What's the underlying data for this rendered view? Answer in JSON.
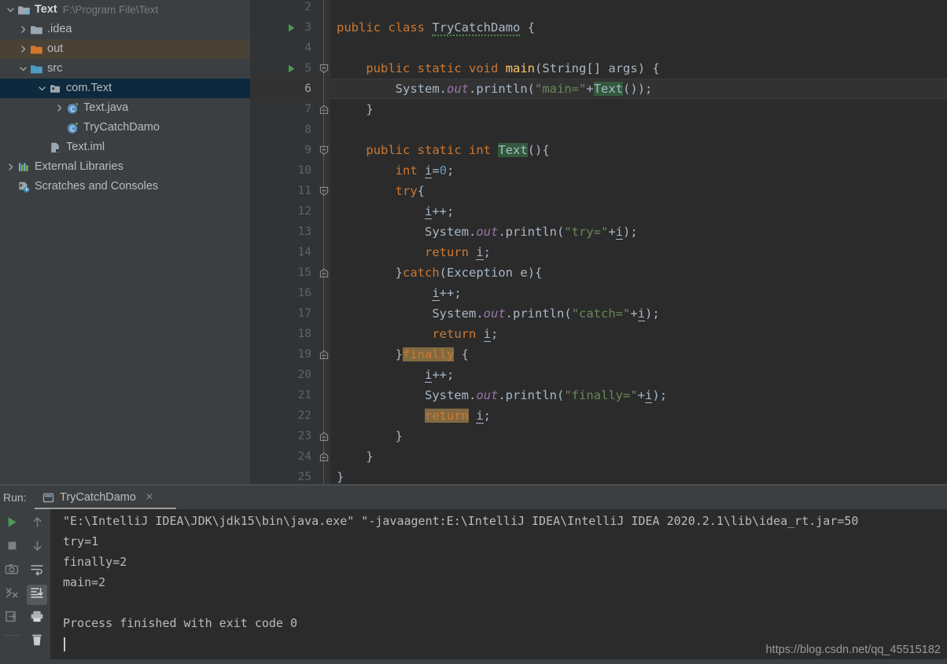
{
  "project_tree": {
    "rows": [
      {
        "label": "Text",
        "path": "F:\\Program File\\Text",
        "icon": "project-folder-icon",
        "twisty": "chevron-down",
        "indent": 0,
        "state": "normal",
        "bold": true
      },
      {
        "label": ".idea",
        "path": "",
        "icon": "folder-grey-icon",
        "twisty": "chevron-right",
        "indent": 1,
        "state": "normal",
        "bold": false
      },
      {
        "label": "out",
        "path": "",
        "icon": "folder-orange-icon",
        "twisty": "chevron-right",
        "indent": 1,
        "state": "hover",
        "bold": false
      },
      {
        "label": "src",
        "path": "",
        "icon": "folder-blue-icon",
        "twisty": "chevron-down",
        "indent": 1,
        "state": "normal",
        "bold": false
      },
      {
        "label": "com.Text",
        "path": "",
        "icon": "package-icon",
        "twisty": "chevron-down",
        "indent": 2,
        "state": "selected",
        "bold": false
      },
      {
        "label": "Text.java",
        "path": "",
        "icon": "java-class-icon",
        "twisty": "chevron-right",
        "indent": 3,
        "state": "normal",
        "bold": false
      },
      {
        "label": "TryCatchDamo",
        "path": "",
        "icon": "java-class-icon",
        "twisty": "none",
        "indent": 3,
        "state": "normal",
        "bold": false
      },
      {
        "label": "Text.iml",
        "path": "",
        "icon": "iml-file-icon",
        "twisty": "none",
        "indent": 2,
        "state": "normal",
        "bold": false
      },
      {
        "label": "External Libraries",
        "path": "",
        "icon": "libraries-icon",
        "twisty": "chevron-right",
        "indent": 0,
        "state": "normal",
        "bold": false
      },
      {
        "label": "Scratches and Consoles",
        "path": "",
        "icon": "scratches-icon",
        "twisty": "none",
        "indent": 0,
        "state": "normal",
        "bold": false
      }
    ]
  },
  "editor": {
    "first_visible_line": 2,
    "current_line": 6,
    "run_marker_lines": [
      3,
      5
    ],
    "bulb_line": 6,
    "fold_markers": [
      {
        "line": 5,
        "type": "open"
      },
      {
        "line": 7,
        "type": "close"
      },
      {
        "line": 9,
        "type": "open"
      },
      {
        "line": 11,
        "type": "open"
      },
      {
        "line": 15,
        "type": "close"
      },
      {
        "line": 19,
        "type": "close"
      },
      {
        "line": 23,
        "type": "close"
      },
      {
        "line": 24,
        "type": "close"
      }
    ],
    "lines": [
      {
        "n": 2,
        "text": ""
      },
      {
        "n": 3,
        "text": "public class TryCatchDamo {"
      },
      {
        "n": 4,
        "text": ""
      },
      {
        "n": 5,
        "text": "    public static void main(String[] args) {"
      },
      {
        "n": 6,
        "text": "        System.out.println(\"main=\"+Text());"
      },
      {
        "n": 7,
        "text": "    }"
      },
      {
        "n": 8,
        "text": ""
      },
      {
        "n": 9,
        "text": "    public static int Text(){"
      },
      {
        "n": 10,
        "text": "        int i=0;"
      },
      {
        "n": 11,
        "text": "        try{"
      },
      {
        "n": 12,
        "text": "            i++;"
      },
      {
        "n": 13,
        "text": "            System.out.println(\"try=\"+i);"
      },
      {
        "n": 14,
        "text": "            return i;"
      },
      {
        "n": 15,
        "text": "        }catch(Exception e){"
      },
      {
        "n": 16,
        "text": "             i++;"
      },
      {
        "n": 17,
        "text": "             System.out.println(\"catch=\"+i);"
      },
      {
        "n": 18,
        "text": "             return i;"
      },
      {
        "n": 19,
        "text": "        }finally {"
      },
      {
        "n": 20,
        "text": "            i++;"
      },
      {
        "n": 21,
        "text": "            System.out.println(\"finally=\"+i);"
      },
      {
        "n": 22,
        "text": "            return i;"
      },
      {
        "n": 23,
        "text": "        }"
      },
      {
        "n": 24,
        "text": "    }"
      },
      {
        "n": 25,
        "text": "}"
      }
    ]
  },
  "run_panel": {
    "label": "Run:",
    "tab_name": "TryCatchDamo",
    "tab_close": "×",
    "toolbar_left": [
      {
        "name": "rerun-button",
        "icon": "play-icon"
      },
      {
        "name": "stop-button",
        "icon": "stop-icon"
      },
      {
        "name": "screenshot-button",
        "icon": "camera-icon"
      },
      {
        "name": "dump-threads-button",
        "icon": "thread-dump-icon"
      },
      {
        "name": "export-button",
        "icon": "export-icon"
      }
    ],
    "toolbar_right": [
      {
        "name": "prev-occurrence-button",
        "icon": "arrow-up-icon"
      },
      {
        "name": "next-occurrence-button",
        "icon": "arrow-down-icon"
      },
      {
        "name": "soft-wrap-button",
        "icon": "soft-wrap-icon"
      },
      {
        "name": "scroll-to-end-button",
        "icon": "scroll-end-icon"
      },
      {
        "name": "print-button",
        "icon": "printer-icon"
      },
      {
        "name": "clear-all-button",
        "icon": "trash-icon"
      }
    ],
    "console_lines": [
      "\"E:\\IntelliJ IDEA\\JDK\\jdk15\\bin\\java.exe\" \"-javaagent:E:\\IntelliJ IDEA\\IntelliJ IDEA 2020.2.1\\lib\\idea_rt.jar=50",
      "try=1",
      "finally=2",
      "main=2",
      "",
      "Process finished with exit code 0"
    ]
  },
  "watermark": "https://blog.csdn.net/qq_45515182",
  "colors": {
    "editor_bg": "#2b2b2b",
    "gutter_bg": "#313335",
    "panel_bg": "#3c3f41",
    "selection_blue": "#0d293e",
    "hover_brown": "#4a4237",
    "keyword": "#cc7832",
    "string": "#6a8759",
    "number": "#6897bb",
    "method": "#ffc66d",
    "field_italic": "#9876aa",
    "default_text": "#a9b7c6",
    "highlight_green": "#32593d",
    "highlight_tan": "#816a41",
    "run_green": "#499c54"
  }
}
